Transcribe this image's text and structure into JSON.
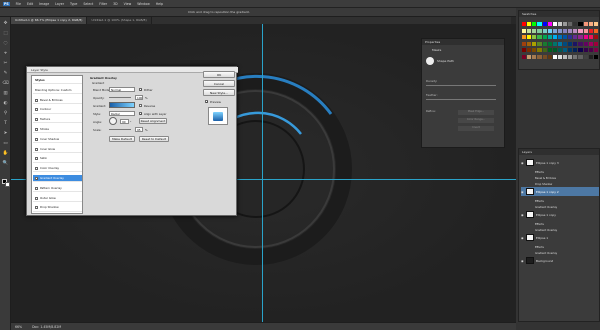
{
  "menubar": {
    "items": [
      "PS",
      "File",
      "Edit",
      "Image",
      "Layer",
      "Type",
      "Select",
      "Filter",
      "3D",
      "View",
      "Window",
      "Help"
    ]
  },
  "options": {
    "hint": "Click and drag to reposition the gradient."
  },
  "tabs": [
    {
      "label": "Untitled-1 @ 66.7% (Ellipse 1 copy 2, RGB/8)",
      "active": true
    },
    {
      "label": "Untitled-1 @ 100% (Shape 1, RGB/8)",
      "active": false
    }
  ],
  "status": {
    "zoom": "66%",
    "doc": "Doc: 1.45M/8.82M"
  },
  "swatches": {
    "title": "Swatches",
    "colors": [
      "#ff0000",
      "#ffff00",
      "#00ff00",
      "#00ffff",
      "#0000ff",
      "#ff00ff",
      "#ffffff",
      "#cccccc",
      "#999999",
      "#666666",
      "#333333",
      "#000000",
      "#f7977a",
      "#f9ad81",
      "#fdc68a",
      "#fff79a",
      "#c4df9b",
      "#a3d39c",
      "#82ca9d",
      "#7bcdc8",
      "#6ecff6",
      "#7ea7d8",
      "#8493ca",
      "#8882be",
      "#a187be",
      "#bc8dbf",
      "#f49ac2",
      "#f6989d",
      "#ed1c24",
      "#f26522",
      "#f7941d",
      "#fff200",
      "#8dc73f",
      "#39b54a",
      "#00a651",
      "#00a99d",
      "#00aeef",
      "#0072bc",
      "#0054a6",
      "#2e3192",
      "#662d91",
      "#92278f",
      "#ec008c",
      "#ed145b",
      "#9e0b0f",
      "#a0410d",
      "#a36209",
      "#aba000",
      "#598527",
      "#197b30",
      "#007236",
      "#00746b",
      "#0076a3",
      "#004b80",
      "#003471",
      "#1b1464",
      "#440e62",
      "#630460",
      "#9e005d",
      "#9e0039",
      "#790000",
      "#7b2e00",
      "#7d4900",
      "#827b00",
      "#406618",
      "#005e20",
      "#005826",
      "#005952",
      "#005b7f",
      "#003663",
      "#002157",
      "#0d004c",
      "#32004b",
      "#4b0049",
      "#7b0046",
      "#7a0026",
      "#c69c6d",
      "#a67c52",
      "#8c6239",
      "#754c24",
      "#603913",
      "#ffffff",
      "#e0e0e0",
      "#bdbdbd",
      "#9e9e9e",
      "#757575",
      "#616161",
      "#424242",
      "#212121",
      "#000000"
    ]
  },
  "properties": {
    "title": "Properties",
    "kind": "Masks",
    "mask": "Shape Path",
    "density_label": "Density:",
    "feather_label": "Feather:",
    "refine_label": "Refine:",
    "btn_mask_edge": "Mask Edge...",
    "btn_color_range": "Color Range...",
    "btn_invert": "Invert"
  },
  "layers": {
    "title": "Layers",
    "items": [
      {
        "name": "Ellipse 1 copy 3",
        "type": "layer",
        "visible": true
      },
      {
        "name": "Effects",
        "type": "sub"
      },
      {
        "name": "Bevel & Emboss",
        "type": "sub"
      },
      {
        "name": "Drop Shadow",
        "type": "sub"
      },
      {
        "name": "Ellipse 1 copy 2",
        "type": "layer",
        "visible": true,
        "selected": true
      },
      {
        "name": "Effects",
        "type": "sub"
      },
      {
        "name": "Gradient Overlay",
        "type": "sub"
      },
      {
        "name": "Ellipse 1 copy",
        "type": "layer",
        "visible": true
      },
      {
        "name": "Effects",
        "type": "sub"
      },
      {
        "name": "Gradient Overlay",
        "type": "sub"
      },
      {
        "name": "Ellipse 1",
        "type": "layer",
        "visible": true
      },
      {
        "name": "Effects",
        "type": "sub"
      },
      {
        "name": "Gradient Overlay",
        "type": "sub"
      },
      {
        "name": "Background",
        "type": "bg",
        "visible": true
      }
    ]
  },
  "dialog": {
    "title": "Layer Style",
    "styles": [
      {
        "label": "Styles",
        "checkbox": false,
        "checked": false
      },
      {
        "label": "Blending Options: Custom",
        "checkbox": false,
        "checked": false
      },
      {
        "label": "Bevel & Emboss",
        "checkbox": true,
        "checked": false
      },
      {
        "label": "Contour",
        "checkbox": true,
        "checked": false
      },
      {
        "label": "Texture",
        "checkbox": true,
        "checked": false
      },
      {
        "label": "Stroke",
        "checkbox": true,
        "checked": false
      },
      {
        "label": "Inner Shadow",
        "checkbox": true,
        "checked": false
      },
      {
        "label": "Inner Glow",
        "checkbox": true,
        "checked": false
      },
      {
        "label": "Satin",
        "checkbox": true,
        "checked": false
      },
      {
        "label": "Color Overlay",
        "checkbox": true,
        "checked": false
      },
      {
        "label": "Gradient Overlay",
        "checkbox": true,
        "checked": true,
        "selected": true
      },
      {
        "label": "Pattern Overlay",
        "checkbox": true,
        "checked": false
      },
      {
        "label": "Outer Glow",
        "checkbox": true,
        "checked": false
      },
      {
        "label": "Drop Shadow",
        "checkbox": true,
        "checked": false
      }
    ],
    "section_title": "Gradient Overlay",
    "section_sub": "Gradient",
    "blend_mode_label": "Blend Mode:",
    "blend_mode_value": "Normal",
    "dither_label": "Dither",
    "opacity_label": "Opacity:",
    "opacity_value": "100",
    "opacity_unit": "%",
    "gradient_label": "Gradient:",
    "reverse_label": "Reverse",
    "style_label": "Style:",
    "style_value": "Radial",
    "align_label": "Align with Layer",
    "angle_label": "Angle:",
    "angle_value": "90",
    "angle_unit": "°",
    "reset_alignment": "Reset Alignment",
    "scale_label": "Scale:",
    "scale_value": "95",
    "scale_unit": "%",
    "make_default": "Make Default",
    "reset_default": "Reset to Default",
    "ok": "OK",
    "cancel": "Cancel",
    "new_style": "New Style...",
    "preview_label": "Preview"
  }
}
